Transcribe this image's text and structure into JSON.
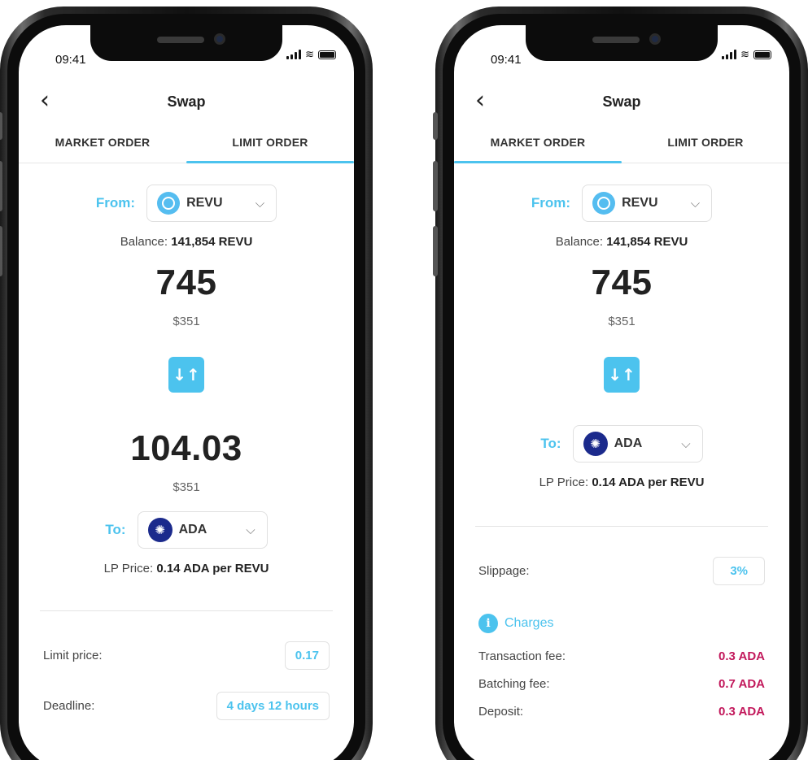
{
  "left_screen": {
    "status_time": "09:41",
    "title": "Swap",
    "tabs": [
      {
        "label": "MARKET ORDER",
        "active": false
      },
      {
        "label": "LIMIT ORDER",
        "active": true
      }
    ],
    "from_label": "From:",
    "from_token": "REVU",
    "balance_label": "Balance:",
    "balance_value": "141,854 REVU",
    "from_amount": "745",
    "from_usd": "$351",
    "swap_icon": "↓↑",
    "to_amount": "104.03",
    "to_usd": "$351",
    "to_label": "To:",
    "to_token": "ADA",
    "lp_label": "LP Price:",
    "lp_value": "0.14 ADA per REVU",
    "limit_price_label": "Limit price:",
    "limit_price_value": "0.17",
    "deadline_label": "Deadline:",
    "deadline_value": "4 days 12 hours"
  },
  "right_screen": {
    "status_time": "09:41",
    "title": "Swap",
    "tabs": [
      {
        "label": "MARKET ORDER",
        "active": true
      },
      {
        "label": "LIMIT ORDER",
        "active": false
      }
    ],
    "from_label": "From:",
    "from_token": "REVU",
    "balance_label": "Balance:",
    "balance_value": "141,854 REVU",
    "from_amount": "745",
    "from_usd": "$351",
    "swap_icon": "↓↑",
    "to_label": "To:",
    "to_token": "ADA",
    "lp_label": "LP Price:",
    "lp_value": "0.14 ADA per REVU",
    "slippage_label": "Slippage:",
    "slippage_value": "3%",
    "charges_label": "Charges",
    "fees": [
      {
        "label": "Transaction fee:",
        "value": "0.3 ADA"
      },
      {
        "label": "Batching fee:",
        "value": "0.7 ADA"
      },
      {
        "label": "Deposit:",
        "value": "0.3 ADA"
      }
    ]
  },
  "colors": {
    "accent": "#4cc3ee",
    "fee": "#c2185b",
    "ada_coin": "#1b2a8c",
    "revu_coin": "#55bdf0"
  },
  "icons": {
    "back": "‹",
    "chevron": "⌵",
    "ada": "✺",
    "info": "i",
    "wifi": "≋"
  }
}
